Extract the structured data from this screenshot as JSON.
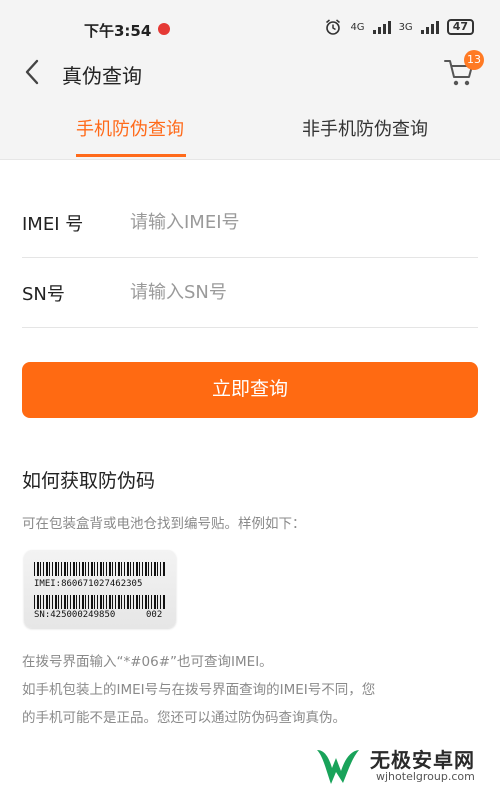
{
  "status": {
    "time": "下午3:54",
    "net1": "4G",
    "net2": "3G",
    "battery": "47"
  },
  "header": {
    "title": "真伪查询",
    "cart_count": "13"
  },
  "tabs": [
    {
      "label": "手机防伪查询",
      "active": true
    },
    {
      "label": "非手机防伪查询",
      "active": false
    }
  ],
  "form": {
    "imei": {
      "label": "IMEI 号",
      "placeholder": "请输入IMEI号",
      "value": ""
    },
    "sn": {
      "label": "SN号",
      "placeholder": "请输入SN号",
      "value": ""
    },
    "submit_label": "立即查询"
  },
  "help": {
    "title": "如何获取防伪码",
    "desc": "可在包装盒背或电池仓找到编号贴。样例如下：",
    "sample": {
      "imei": "IMEI:860671027462305",
      "sn": "SN:425000249850",
      "sn_suffix": "002"
    },
    "notes": [
      "在拨号界面输入“*#06#”也可查询IMEI。",
      "如手机包装上的IMEI号与在拨号界面查询的IMEI号不同，您",
      "的手机可能不是正品。您还可以通过防伪码查询真伪。"
    ]
  },
  "watermark": {
    "name": "无极安卓网",
    "url": "wjhotelgroup.com"
  },
  "colors": {
    "accent": "#ff6a12",
    "badge": "#ff7a24",
    "header_bg": "#f4f4f4"
  },
  "icons": [
    "back-chevron-icon",
    "cart-icon",
    "alarm-clock-icon",
    "signal-icon",
    "battery-icon"
  ]
}
